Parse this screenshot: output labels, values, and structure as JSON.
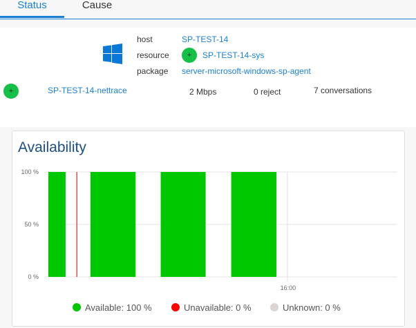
{
  "tabs": [
    {
      "label": "Status",
      "active": true
    },
    {
      "label": "Cause",
      "active": false
    }
  ],
  "info": {
    "host_label": "host",
    "host_value": "SP-TEST-14",
    "resource_label": "resource",
    "resource_value": "SP-TEST-14-sys",
    "package_label": "package",
    "package_value": "server-microsoft-windows-sp-agent",
    "status_icon": "+",
    "nettrace": {
      "name": "SP-TEST-14-nettrace",
      "rate": "2 Mbps",
      "reject": "0 reject",
      "conversations": "7 conversations"
    }
  },
  "colors": {
    "available": "#00c800",
    "unavailable": "#ff0000",
    "unknown": "#d9d6d3",
    "accent": "#1a7fd4"
  },
  "chart_data": {
    "type": "bar",
    "title": "Availability",
    "ylabel": "",
    "xlabel": "",
    "ylim": [
      0,
      100
    ],
    "yticks": [
      "0 %",
      "50 %",
      "100 %"
    ],
    "x_unit": "minutes from start of window",
    "xlim": [
      0,
      146
    ],
    "xticks": [
      {
        "label": "16:00",
        "x": 100
      }
    ],
    "available_segments": [
      [
        0,
        7.2,
        100
      ],
      [
        17.6,
        36.5,
        100
      ],
      [
        47,
        65.8,
        100
      ],
      [
        76.5,
        95.4,
        100
      ]
    ],
    "unavailable_markers": [
      11.9
    ],
    "grid": true,
    "legend": [
      {
        "label": "Available: 100 %",
        "key": "available"
      },
      {
        "label": "Unavailable: 0 %",
        "key": "unavailable"
      },
      {
        "label": "Unknown: 0 %",
        "key": "unknown"
      }
    ],
    "legend_position": "bottom"
  }
}
